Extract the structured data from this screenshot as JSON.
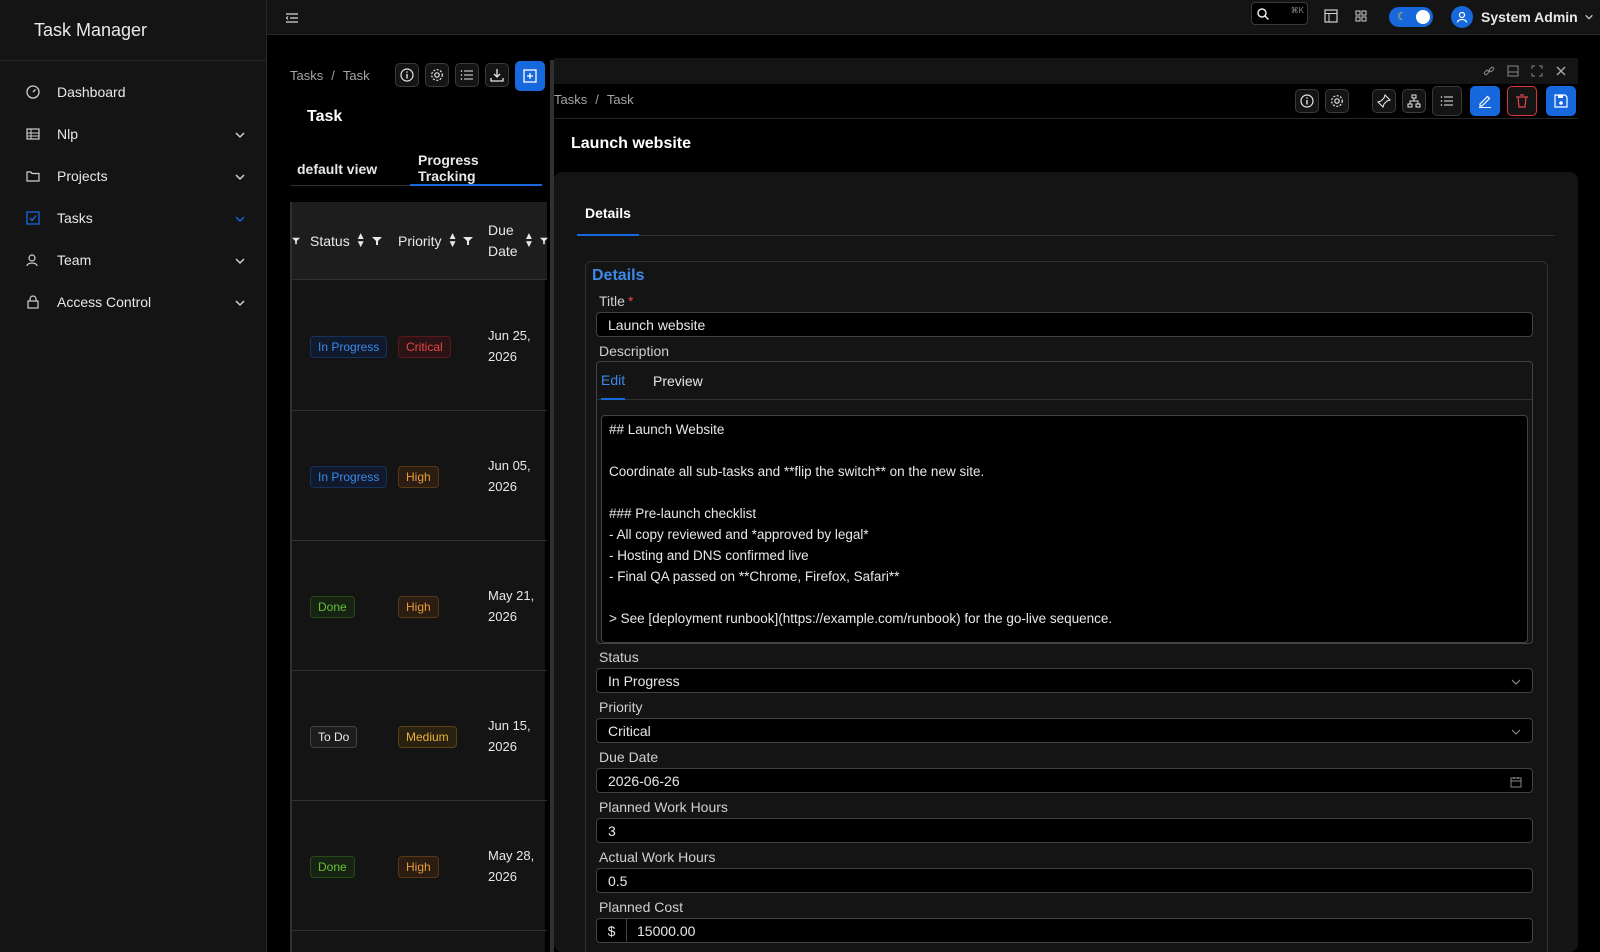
{
  "app": {
    "title": "Task Manager"
  },
  "sidebar": {
    "items": [
      {
        "label": "Dashboard",
        "icon": "dashboard-icon"
      },
      {
        "label": "Nlp",
        "icon": "table-icon"
      },
      {
        "label": "Projects",
        "icon": "folder-icon"
      },
      {
        "label": "Tasks",
        "icon": "checkbox-icon",
        "active": true
      },
      {
        "label": "Team",
        "icon": "team-icon"
      },
      {
        "label": "Access Control",
        "icon": "lock-icon"
      }
    ]
  },
  "topbar": {
    "search_shortcut": "⌘K",
    "user_name": "System Admin",
    "theme_icon": "☾"
  },
  "list": {
    "breadcrumb": [
      "Tasks",
      "Task"
    ],
    "title": "Task",
    "views": [
      "default view",
      "Progress Tracking"
    ],
    "columns": [
      "Status",
      "Priority",
      "Due Date"
    ],
    "due_header": [
      "Due",
      "Date"
    ],
    "rows": [
      {
        "status": "In Progress",
        "status_color": "blue",
        "priority": "Critical",
        "priority_color": "red",
        "due_1": "Jun 25,",
        "due_2": "2026"
      },
      {
        "status": "In Progress",
        "status_color": "blue",
        "priority": "High",
        "priority_color": "orange",
        "due_1": "Jun 05,",
        "due_2": "2026"
      },
      {
        "status": "Done",
        "status_color": "green",
        "priority": "High",
        "priority_color": "orange",
        "due_1": "May 21,",
        "due_2": "2026"
      },
      {
        "status": "To Do",
        "status_color": "default",
        "priority": "Medium",
        "priority_color": "gold",
        "due_1": "Jun 15,",
        "due_2": "2026"
      },
      {
        "status": "Done",
        "status_color": "green",
        "priority": "High",
        "priority_color": "orange",
        "due_1": "May 28,",
        "due_2": "2026"
      }
    ]
  },
  "detail": {
    "breadcrumb": [
      "Tasks",
      "Task"
    ],
    "title": "Launch website",
    "tab": "Details",
    "section": "Details",
    "fields": {
      "title_label": "Title",
      "required_mark": "*",
      "title_value": "Launch website",
      "description_label": "Description",
      "md_tab_edit": "Edit",
      "md_tab_preview": "Preview",
      "description_value": "## Launch Website\n\nCoordinate all sub-tasks and **flip the switch** on the new site.\n\n### Pre-launch checklist\n- All copy reviewed and *approved by legal*\n- Hosting and DNS confirmed live\n- Final QA passed on **Chrome, Firefox, Safari**\n\n> See [deployment runbook](https://example.com/runbook) for the go-live sequence.",
      "status_label": "Status",
      "status_value": "In Progress",
      "priority_label": "Priority",
      "priority_value": "Critical",
      "due_label": "Due Date",
      "due_value": "2026-06-26",
      "planned_hours_label": "Planned Work Hours",
      "planned_hours_value": "3",
      "actual_hours_label": "Actual Work Hours",
      "actual_hours_value": "0.5",
      "planned_cost_label": "Planned Cost",
      "currency_prefix": "$",
      "planned_cost_value": "15000.00"
    }
  },
  "colors": {
    "accent": "#1668dc",
    "danger": "#d9363e",
    "link": "#3c89e8"
  }
}
